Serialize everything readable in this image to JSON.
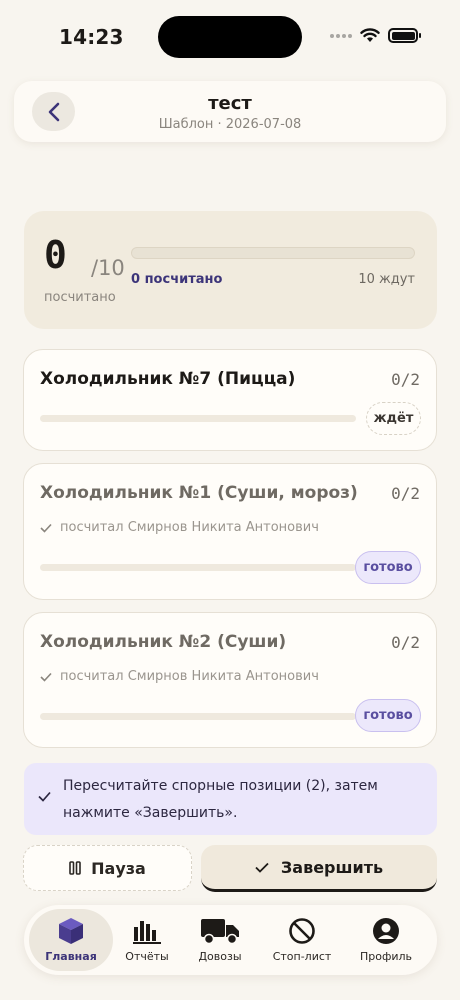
{
  "status_bar": {
    "time": "14:23"
  },
  "header": {
    "title": "тест",
    "subtitle": "Шаблон · 2026-07-08"
  },
  "summary": {
    "counted": "0",
    "total": "/10",
    "counted_label": "посчитано",
    "progress_fraction": 0,
    "counted_text": "0 посчитано",
    "waiting_text": "10 ждут"
  },
  "fridges": [
    {
      "title": "Холодильник №7 (Пицца)",
      "count": "0/2",
      "status": "ждёт",
      "progress_fraction": 0,
      "counted_by": ""
    },
    {
      "title": "Холодильник №1 (Суши, мороз)",
      "count": "0/2",
      "status": "готово",
      "progress_fraction": 0,
      "counted_by": "посчитал Смирнов Никита Антонович"
    },
    {
      "title": "Холодильник №2 (Суши)",
      "count": "0/2",
      "status": "готово",
      "progress_fraction": 0,
      "counted_by": "посчитал Смирнов Никита Антонович"
    }
  ],
  "info": {
    "text": "Пересчитайте спорные позиции (2), затем нажмите «Завершить»."
  },
  "actions": {
    "pause_label": "Пауза",
    "finish_label": "Завершить"
  },
  "tabs": [
    {
      "label": "Главная",
      "icon": "cube-icon",
      "active": true
    },
    {
      "label": "Отчёты",
      "icon": "bar-chart-icon",
      "active": false
    },
    {
      "label": "Довозы",
      "icon": "truck-icon",
      "active": false
    },
    {
      "label": "Стоп-лист",
      "icon": "prohibited-icon",
      "active": false
    },
    {
      "label": "Профиль",
      "icon": "user-icon",
      "active": false
    }
  ],
  "colors": {
    "accent": "#4a3d8f",
    "background": "#f8f5ef",
    "done_pill": "#ece8fb"
  }
}
